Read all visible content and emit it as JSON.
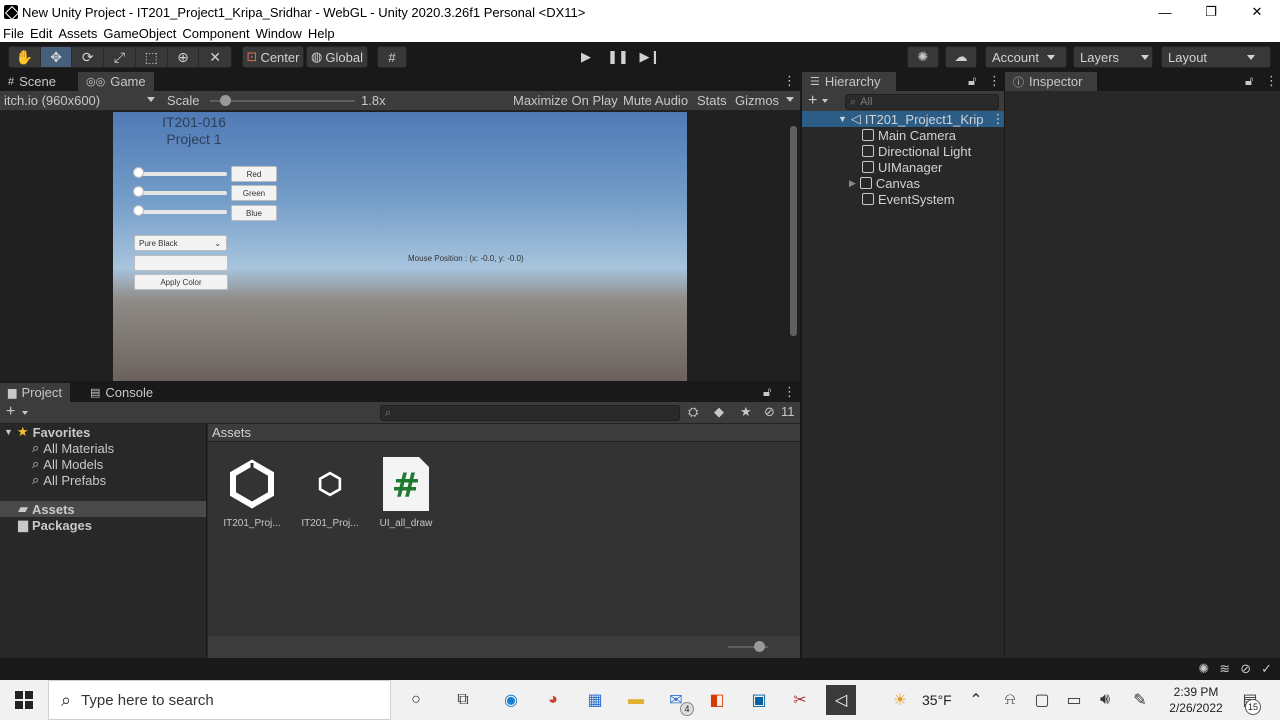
{
  "window": {
    "title": "New Unity Project - IT201_Project1_Kripa_Sridhar - WebGL - Unity 2020.3.26f1 Personal <DX11>",
    "min_glyph": "—",
    "restore_glyph": "❐",
    "close_glyph": "✕"
  },
  "menu": [
    "File",
    "Edit",
    "Assets",
    "GameObject",
    "Component",
    "Window",
    "Help"
  ],
  "toolbar": {
    "pivot_label": "Center",
    "space_label": "Global",
    "account_label": "Account",
    "layers_label": "Layers",
    "layout_label": "Layout"
  },
  "game_panel": {
    "tabs": [
      "Scene",
      "Game"
    ],
    "resolution": "itch.io (960x600)",
    "scale_label": "Scale",
    "scale_value": "1.8x",
    "scale_fraction": 0.1,
    "maximize_label": "Maximize On Play",
    "mute_label": "Mute Audio",
    "stats_label": "Stats",
    "gizmos_label": "Gizmos"
  },
  "game_view": {
    "title_line1": "IT201-016",
    "title_line2": "Project 1",
    "red_label": "Red",
    "green_label": "Green",
    "blue_label": "Blue",
    "dropdown_value": "Pure Black",
    "apply_label": "Apply Color",
    "mouse_position": "Mouse Position : (x: -0.0, y: -0.0)"
  },
  "hierarchy": {
    "tab": "Hierarchy",
    "search_placeholder": "All",
    "root": "IT201_Project1_Krip",
    "items": [
      "Main Camera",
      "Directional Light",
      "UIManager",
      "Canvas",
      "EventSystem"
    ]
  },
  "inspector": {
    "tab": "Inspector"
  },
  "project": {
    "tabs": [
      "Project",
      "Console"
    ],
    "hidden_count": "11",
    "favorites_label": "Favorites",
    "favorites": [
      "All Materials",
      "All Models",
      "All Prefabs"
    ],
    "folders": [
      "Assets",
      "Packages"
    ],
    "assets_header": "Assets",
    "assets": [
      "IT201_Proj...",
      "IT201_Proj...",
      "UI_all_draw"
    ]
  },
  "taskbar": {
    "search_placeholder": "Type here to search",
    "mail_badge": "4",
    "temperature": "35°F",
    "time": "2:39 PM",
    "date": "2/26/2022",
    "notification_count": "15"
  }
}
